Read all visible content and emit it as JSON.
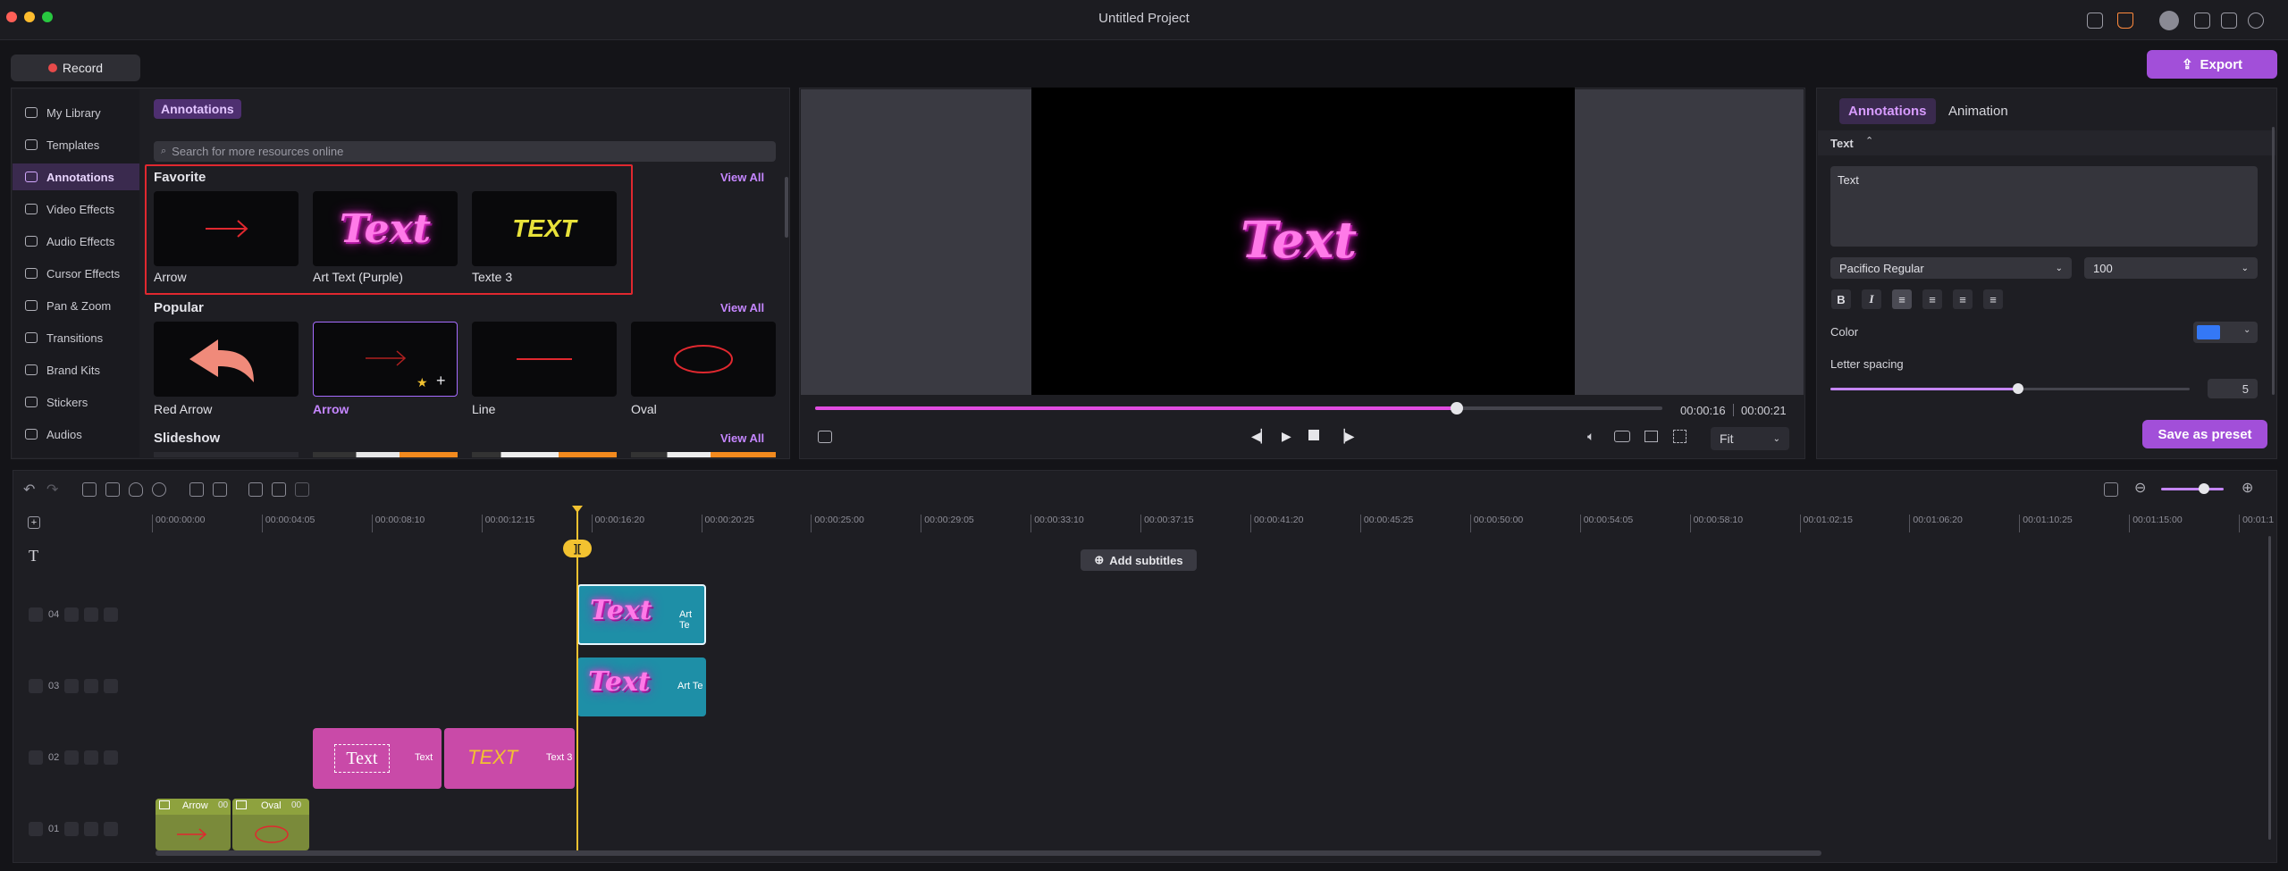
{
  "window": {
    "title": "Untitled Project"
  },
  "toolbar": {
    "record_label": "Record",
    "export_label": "Export"
  },
  "sidebar": {
    "items": [
      {
        "label": "My Library",
        "icon": "layers-icon"
      },
      {
        "label": "Templates",
        "icon": "template-icon"
      },
      {
        "label": "Annotations",
        "icon": "annotation-icon",
        "active": true
      },
      {
        "label": "Video Effects",
        "icon": "video-effects-icon"
      },
      {
        "label": "Audio Effects",
        "icon": "audio-effects-icon"
      },
      {
        "label": "Cursor Effects",
        "icon": "cursor-icon"
      },
      {
        "label": "Pan & Zoom",
        "icon": "zoom-icon"
      },
      {
        "label": "Transitions",
        "icon": "transition-icon"
      },
      {
        "label": "Brand Kits",
        "icon": "brand-kit-icon"
      },
      {
        "label": "Stickers",
        "icon": "sticker-icon"
      },
      {
        "label": "Audios",
        "icon": "music-icon"
      }
    ]
  },
  "library": {
    "chip": "Annotations",
    "search_placeholder": "Search for more resources online",
    "favorite": {
      "title": "Favorite",
      "view_all": "View All",
      "items": [
        {
          "label": "Arrow"
        },
        {
          "label": "Art Text (Purple)",
          "thumb_text": "Text"
        },
        {
          "label": "Texte 3",
          "thumb_text": "TEXT"
        }
      ]
    },
    "popular": {
      "title": "Popular",
      "view_all": "View All",
      "items": [
        {
          "label": "Red Arrow"
        },
        {
          "label": "Arrow"
        },
        {
          "label": "Line"
        },
        {
          "label": "Oval"
        }
      ]
    },
    "slideshow": {
      "title": "Slideshow",
      "view_all": "View All"
    }
  },
  "preview": {
    "canvas_text": "Text",
    "current_time": "00:00:16",
    "total_time": "00:00:21",
    "progress": 0.757,
    "fit_label": "Fit"
  },
  "properties": {
    "tabs": [
      "Annotations",
      "Animation"
    ],
    "section": "Text",
    "text_value": "Text",
    "font": "Pacifico Regular",
    "size": "100",
    "format_buttons": [
      "B",
      "I"
    ],
    "color_label": "Color",
    "color_value": "#3478f6",
    "letter_spacing_label": "Letter spacing",
    "letter_spacing_value": "5",
    "save_preset_label": "Save as preset"
  },
  "timeline": {
    "ruler": [
      "00:00:00:00",
      "00:00:04:05",
      "00:00:08:10",
      "00:00:12:15",
      "00:00:16:20",
      "00:00:20:25",
      "00:00:25:00",
      "00:00:29:05",
      "00:00:33:10",
      "00:00:37:15",
      "00:00:41:20",
      "00:00:45:25",
      "00:00:50:00",
      "00:00:54:05",
      "00:00:58:10",
      "00:01:02:15",
      "00:01:06:20",
      "00:01:10:25",
      "00:01:15:00",
      "00:01:1"
    ],
    "add_subtitles": "Add subtitles",
    "playhead_label": "][",
    "tracks": [
      "04",
      "03",
      "02",
      "01"
    ],
    "clips": {
      "t04": {
        "thumb": "Text",
        "label": "Art Te"
      },
      "t03": {
        "thumb": "Text",
        "label": "Art Te"
      },
      "t02a": {
        "thumb": "Text",
        "label": "Text "
      },
      "t02b": {
        "thumb": "TEXT",
        "label": "Text 3"
      },
      "t01a": {
        "label": "Arrow",
        "badge": "00"
      },
      "t01b": {
        "label": "Oval",
        "badge": "00"
      }
    }
  }
}
